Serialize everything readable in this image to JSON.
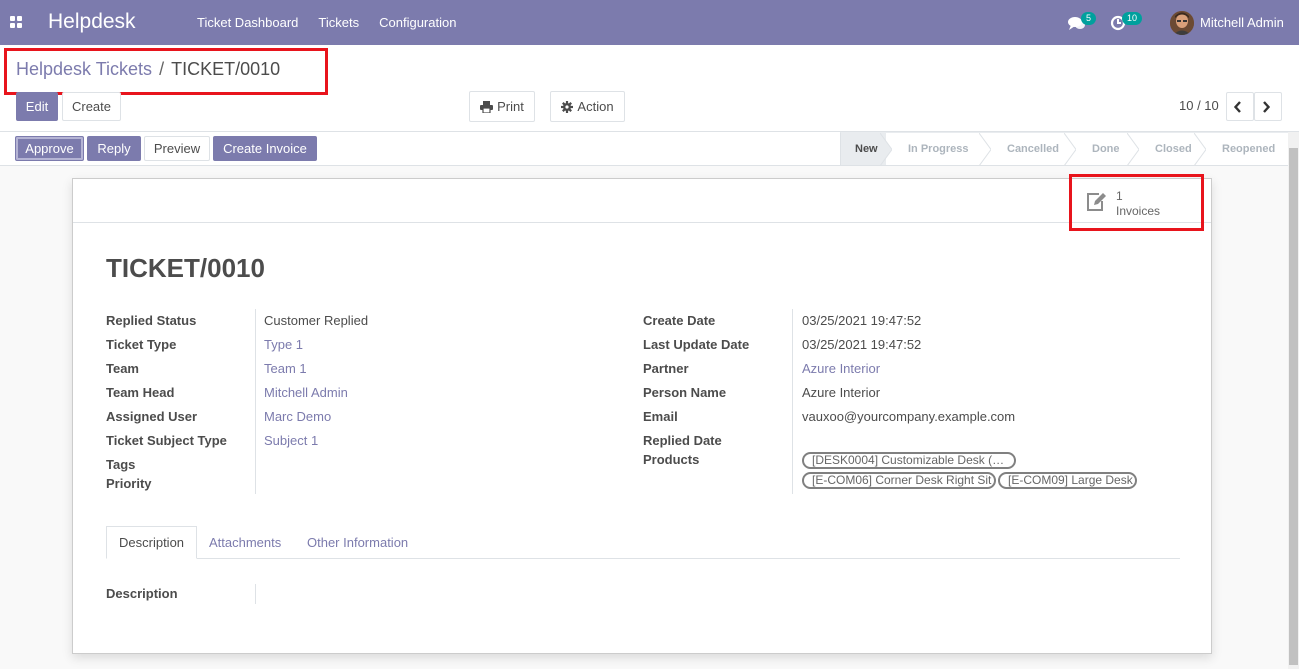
{
  "navbar": {
    "app_name": "Helpdesk",
    "menu": [
      "Ticket Dashboard",
      "Tickets",
      "Configuration"
    ],
    "messages_count": "5",
    "activities_count": "10",
    "user_name": "Mitchell Admin"
  },
  "breadcrumb": {
    "parent": "Helpdesk Tickets",
    "separator": "/",
    "current": "TICKET/0010"
  },
  "toolbar": {
    "edit_label": "Edit",
    "create_label": "Create",
    "print_label": "Print",
    "action_label": "Action",
    "pager": "10 / 10"
  },
  "header_buttons": {
    "approve": "Approve",
    "reply": "Reply",
    "preview": "Preview",
    "create_invoice": "Create Invoice"
  },
  "stages": [
    "New",
    "In Progress",
    "Cancelled",
    "Done",
    "Closed",
    "Reopened"
  ],
  "active_stage": "New",
  "smart_button": {
    "value": "1",
    "label": "Invoices"
  },
  "ticket": {
    "title": "TICKET/0010",
    "left_fields": [
      {
        "label": "Replied Status",
        "value": "Customer Replied",
        "link": false
      },
      {
        "label": "Ticket Type",
        "value": "Type 1",
        "link": true
      },
      {
        "label": "Team",
        "value": "Team 1",
        "link": true
      },
      {
        "label": "Team Head",
        "value": "Mitchell Admin",
        "link": true
      },
      {
        "label": "Assigned User",
        "value": "Marc Demo",
        "link": true
      },
      {
        "label": "Ticket Subject Type",
        "value": "Subject 1",
        "link": true
      },
      {
        "label": "Tags",
        "value": "",
        "link": false
      },
      {
        "label": "Priority",
        "value": "",
        "link": false
      }
    ],
    "right_fields": [
      {
        "label": "Create Date",
        "value": "03/25/2021 19:47:52",
        "link": false
      },
      {
        "label": "Last Update Date",
        "value": "03/25/2021 19:47:52",
        "link": false
      },
      {
        "label": "Partner",
        "value": "Azure Interior",
        "link": true
      },
      {
        "label": "Person Name",
        "value": "Azure Interior",
        "link": false
      },
      {
        "label": "Email",
        "value": "vauxoo@yourcompany.example.com",
        "link": false
      },
      {
        "label": "Replied Date",
        "value": "",
        "link": false
      },
      {
        "label": "Products",
        "value": "",
        "link": false
      }
    ],
    "products": [
      "[DESK0004] Customizable Desk (…",
      "[E-COM06] Corner Desk Right Sit",
      "[E-COM09] Large Desk"
    ]
  },
  "tabs": [
    "Description",
    "Attachments",
    "Other Information"
  ],
  "description_label": "Description",
  "colors": {
    "brand": "#7c7bad",
    "badge": "#00a09d",
    "highlight": "#e8141c"
  }
}
